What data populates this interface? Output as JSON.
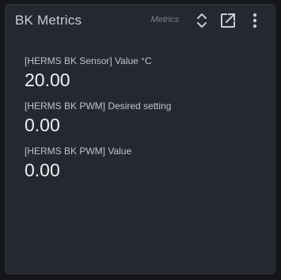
{
  "card": {
    "title": "BK Metrics",
    "subtitle": "Metrics",
    "icons": {
      "sort": "unfold-more-icon",
      "open": "open-in-new-icon",
      "menu": "more-vertical-icon"
    }
  },
  "metrics": [
    {
      "label": "[HERMS BK Sensor] Value °C",
      "value": "20.00"
    },
    {
      "label": "[HERMS BK PWM] Desired setting",
      "value": "0.00"
    },
    {
      "label": "[HERMS BK PWM] Value",
      "value": "0.00"
    }
  ],
  "colors": {
    "page_background": "#15161a",
    "card_background": "#252830",
    "title_text": "#c8ccd4",
    "value_text": "#eef0f4",
    "icon": "#c8ccd4"
  }
}
